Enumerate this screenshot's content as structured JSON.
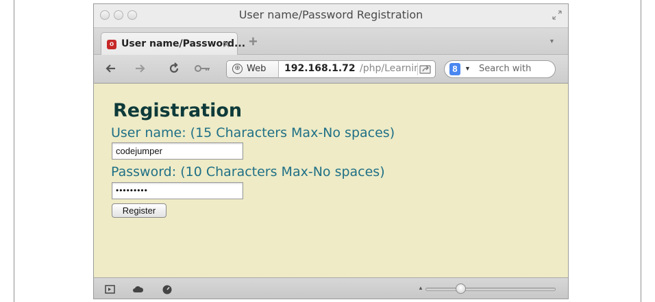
{
  "window": {
    "title": "User name/Password Registration"
  },
  "tabs": [
    {
      "label": "User name/Password...",
      "active": true
    }
  ],
  "toolbar": {
    "address": {
      "scheme_label": "Web",
      "host": "192.168.1.72",
      "path": "/php/Learning"
    },
    "search": {
      "placeholder": "Search with"
    }
  },
  "page": {
    "background": "#eeebc6",
    "heading": "Registration",
    "username": {
      "label": "User name: (15 Characters Max-No spaces)",
      "value": "codejumper"
    },
    "password": {
      "label": "Password: (10 Characters Max-No spaces)",
      "masked_value": "•••••••••"
    },
    "submit_label": "Register"
  },
  "statusbar": {
    "zoom_fraction": 0.25
  },
  "colors": {
    "heading": "#0e3a3a",
    "label": "#1f6f86",
    "page_background": "#eeebc6"
  },
  "icons": [
    "close-traffic-icon",
    "minimize-traffic-icon",
    "zoom-traffic-icon",
    "fullscreen-icon",
    "favicon-icon",
    "tab-close-icon",
    "new-tab-icon",
    "tab-list-icon",
    "back-icon",
    "forward-icon",
    "reload-icon",
    "key-icon",
    "globe-icon",
    "share-icon",
    "google-icon",
    "search-dropdown-icon",
    "sidebar-toggle-icon",
    "cloud-icon",
    "speedometer-icon"
  ]
}
